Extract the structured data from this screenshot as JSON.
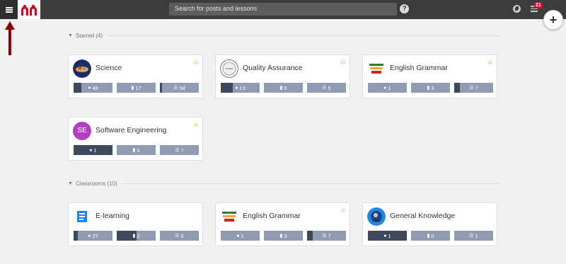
{
  "header": {
    "search_placeholder": "Search for posts and lessons",
    "help_label": "?",
    "notification_count": "21",
    "add_label": "+"
  },
  "sections": {
    "starred": {
      "title": "Starred (4)"
    },
    "classrooms": {
      "title": "Classrooms (10)"
    }
  },
  "icons": {
    "menu": "menu-icon",
    "logo": "app-logo",
    "help": "help-icon",
    "globe": "globe-icon",
    "inbox": "inbox-icon",
    "comment": "comment-icon",
    "book": "book-icon",
    "list": "list-icon",
    "star": "star-icon"
  },
  "colors": {
    "topbar": "#3c3c3c",
    "stat_bg": "#8e9bb0",
    "stat_fill": "#3e4a5b",
    "star": "#e07b00",
    "badge": "#c8102e",
    "annotation_arrow": "#8b0000"
  },
  "starred_cards": [
    {
      "name": "Science",
      "starred": true,
      "avatar": "science",
      "stats": [
        {
          "value": "48",
          "fill": 0.2
        },
        {
          "value": "17",
          "fill": 0
        },
        {
          "value": "58",
          "fill": 0.05
        }
      ]
    },
    {
      "name": "Quality Assurance",
      "starred": true,
      "avatar": "qa",
      "stats": [
        {
          "value": "13",
          "fill": 0.3
        },
        {
          "value": "6",
          "fill": 0
        },
        {
          "value": "5",
          "fill": 0
        }
      ]
    },
    {
      "name": "English Grammar",
      "starred": true,
      "avatar": "grammar",
      "stats": [
        {
          "value": "1",
          "fill": 0
        },
        {
          "value": "3",
          "fill": 0
        },
        {
          "value": "7",
          "fill": 0.15
        }
      ]
    },
    {
      "name": "Software Engineering",
      "starred": true,
      "avatar": "se",
      "initials": "SE",
      "stats": [
        {
          "value": "1",
          "fill": 1
        },
        {
          "value": "5",
          "fill": 0
        },
        {
          "value": "7",
          "fill": 0
        }
      ]
    }
  ],
  "classroom_cards": [
    {
      "name": "E-learning",
      "starred": false,
      "avatar": "elearning",
      "stats": [
        {
          "value": "27",
          "fill": 0.1
        },
        {
          "value": "2",
          "fill": 0.5
        },
        {
          "value": "6",
          "fill": 0
        }
      ]
    },
    {
      "name": "English Grammar",
      "starred": true,
      "avatar": "grammar",
      "stats": [
        {
          "value": "1",
          "fill": 0
        },
        {
          "value": "3",
          "fill": 0
        },
        {
          "value": "7",
          "fill": 0.15
        }
      ]
    },
    {
      "name": "General Knowledge",
      "starred": false,
      "avatar": "gk",
      "stats": [
        {
          "value": "1",
          "fill": 1
        },
        {
          "value": "0",
          "fill": 0
        },
        {
          "value": "1",
          "fill": 0
        }
      ]
    }
  ]
}
